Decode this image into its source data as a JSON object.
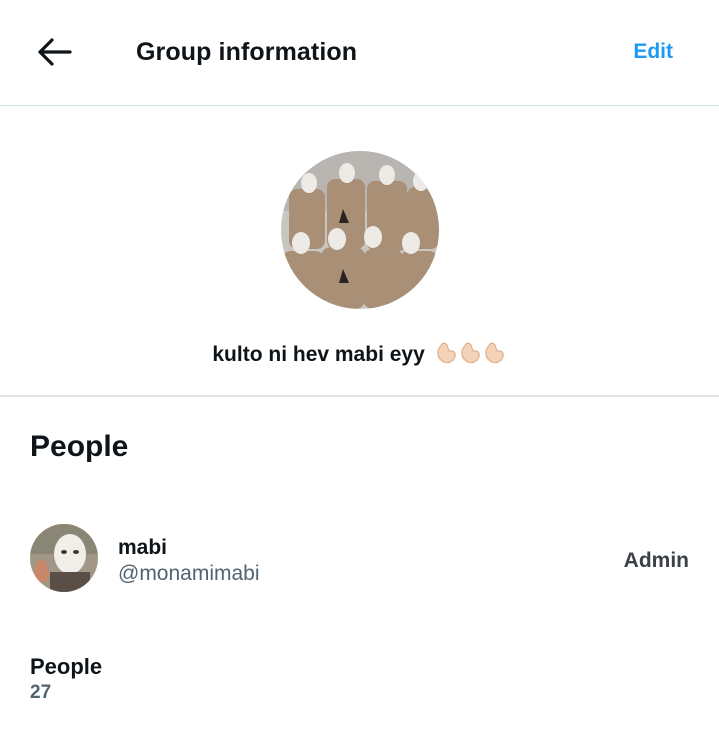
{
  "header": {
    "title": "Group information",
    "edit_label": "Edit",
    "back_icon": "arrow-left-icon"
  },
  "group": {
    "name": "kulto ni hev mabi eyy",
    "emojis": [
      "call-me-hand",
      "call-me-hand",
      "call-me-hand"
    ]
  },
  "people": {
    "heading": "People",
    "members": [
      {
        "name": "mabi",
        "handle": "@monamimabi",
        "role": "Admin"
      }
    ],
    "count_label": "People",
    "count_value": "27"
  },
  "colors": {
    "accent": "#1d9bf0",
    "text_primary": "#0f1419",
    "text_secondary": "#536471"
  }
}
